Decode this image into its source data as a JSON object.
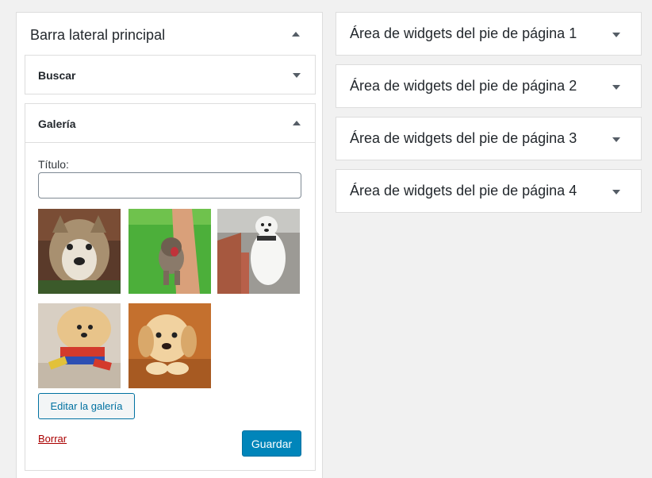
{
  "sidebar": {
    "title": "Barra lateral principal",
    "widgets": {
      "search": {
        "title": "Buscar"
      },
      "gallery": {
        "title": "Galería",
        "title_label": "Título:",
        "title_value": "",
        "images": [
          {
            "alt": "husky-dog-photo"
          },
          {
            "alt": "puppy-on-grass-photo"
          },
          {
            "alt": "samoyed-standing-photo"
          },
          {
            "alt": "pomeranian-in-sweater-photo"
          },
          {
            "alt": "golden-retriever-puppy-photo"
          }
        ],
        "edit_button": "Editar la galería",
        "delete_link": "Borrar",
        "save_button": "Guardar"
      }
    }
  },
  "footer_areas": [
    {
      "label": "Área de widgets del pie de página 1"
    },
    {
      "label": "Área de widgets del pie de página 2"
    },
    {
      "label": "Área de widgets del pie de página 3"
    },
    {
      "label": "Área de widgets del pie de página 4"
    }
  ],
  "colors": {
    "primary_button": "#0085ba",
    "link_delete": "#aa0000",
    "border": "#dddddd",
    "background": "#f1f1f1"
  }
}
